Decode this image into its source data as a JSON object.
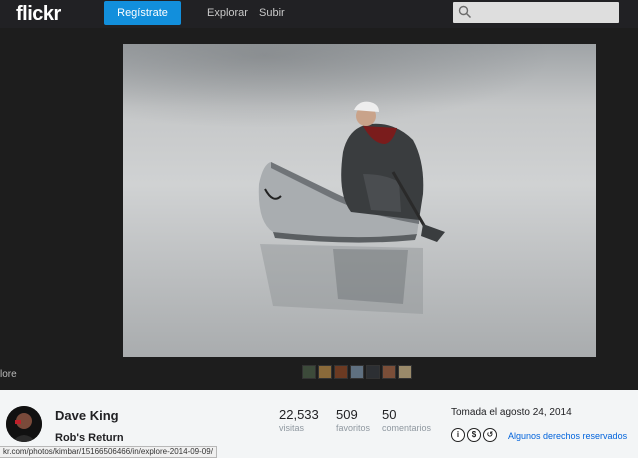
{
  "header": {
    "logo": "flickr",
    "signup_label": "Regístrate",
    "nav": {
      "explore": "Explorar",
      "upload": "Subir"
    },
    "search_placeholder": ""
  },
  "photo": {
    "more_label": "lore",
    "thumbnail_count": 7
  },
  "info": {
    "author": "Dave King",
    "title": "Rob's Return",
    "stats": {
      "views": {
        "value": "22,533",
        "label": "visitas"
      },
      "faves": {
        "value": "509",
        "label": "favoritos"
      },
      "comments": {
        "value": "50",
        "label": "comentarios"
      }
    },
    "taken": "Tomada el agosto 24, 2014",
    "license_text": "Algunos derechos reservados"
  },
  "status_bar": {
    "url": "kr.com/photos/kimbar/15166506466/in/explore-2014-09-09/"
  },
  "colors": {
    "accent": "#128fdc",
    "link": "#0063dc",
    "topbar": "#212124"
  }
}
